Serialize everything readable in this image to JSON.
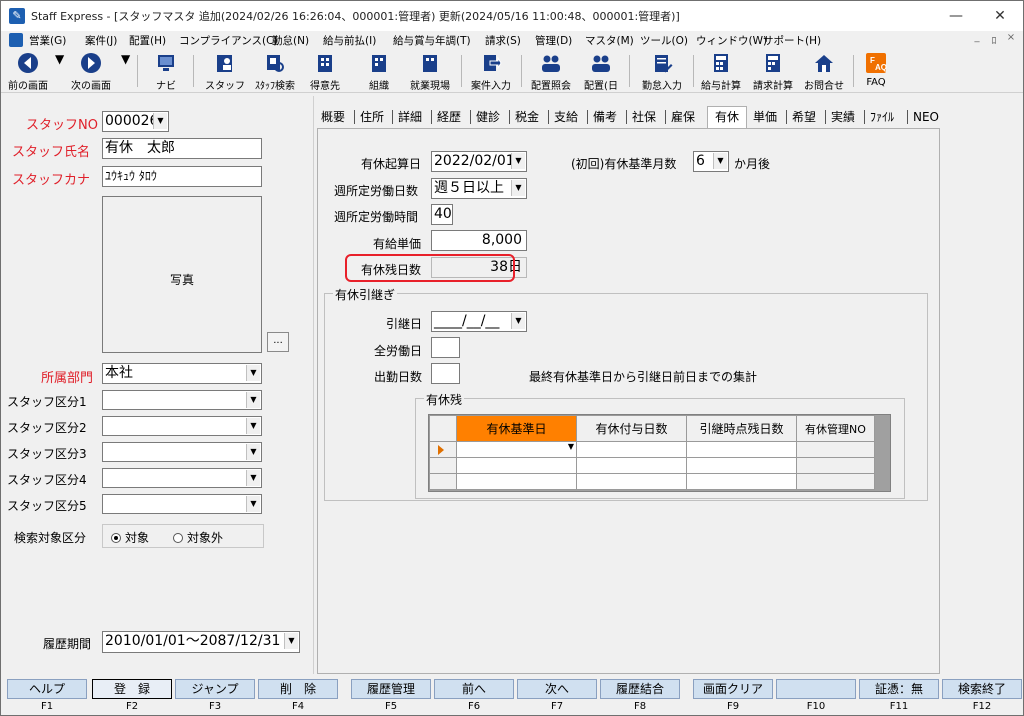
{
  "window": {
    "title": "Staff Express - [スタッフマスタ 追加(2024/02/26 16:26:04、000001:管理者) 更新(2024/05/16 11:00:48、000001:管理者)]",
    "minimize": "—",
    "maximize": "☐",
    "close": "✕"
  },
  "menu": {
    "items": [
      "営業(G)",
      "案件(J)",
      "配置(H)",
      "コンプライアンス(C)",
      "勤怠(N)",
      "給与前払(I)",
      "給与賞与年調(T)",
      "請求(S)",
      "管理(D)",
      "マスタ(M)",
      "ツール(O)",
      "ウィンドウ(W)",
      "サポート(H)"
    ],
    "mdi_min": "_",
    "mdi_restore": "ﾛ",
    "mdi_close": "×"
  },
  "toolbar": {
    "prev": "前の画面",
    "next": "次の画面",
    "navi": "ナビ",
    "staff": "スタッフ",
    "staff_search": "ｽﾀｯﾌ検索",
    "customer": "得意先",
    "org": "組織",
    "site": "就業現場",
    "job_input": "案件入力",
    "assign_ref": "配置照会",
    "assign_day": "配置(日",
    "attendance_input": "勤怠入力",
    "payroll": "給与計算",
    "billing": "請求計算",
    "inquiry": "お問合せ",
    "faq": "FAQ"
  },
  "left": {
    "staff_no_label": "スタッフNO",
    "staff_no": "000026",
    "staff_name_label": "スタッフ氏名",
    "staff_name": "有休　太郎",
    "staff_kana_label": "スタッフカナ",
    "staff_kana": "ﾕｳｷｭｳ ﾀﾛｳ",
    "photo_label": "写真",
    "photo_button": "...",
    "dept_label": "所属部門",
    "dept": "本社",
    "category1_label": "スタッフ区分1",
    "category2_label": "スタッフ区分2",
    "category3_label": "スタッフ区分3",
    "category4_label": "スタッフ区分4",
    "category5_label": "スタッフ区分5",
    "search_target_label": "検索対象区分",
    "search_on": "対象",
    "search_off": "対象外",
    "history_label": "履歴期間",
    "history_period": "2010/01/01～2087/12/31"
  },
  "tabs": [
    "概要",
    "住所",
    "詳細",
    "経歴",
    "健診",
    "税金",
    "支給",
    "備考",
    "社保",
    "雇保",
    "有休",
    "単価",
    "希望",
    "実績",
    "ﾌｧｲﾙ",
    "NEO"
  ],
  "active_tab": "有休",
  "leave": {
    "start_date_label": "有休起算日",
    "start_date": "2022/02/01",
    "base_month_label": "(初回)有休基準月数",
    "base_month": "6",
    "base_month_suffix": "か月後",
    "weekly_days_label": "週所定労働日数",
    "weekly_days": "週５日以上",
    "weekly_hours_label": "週所定労働時間",
    "weekly_hours": "40",
    "unit_price_label": "有給単価",
    "unit_price": "8,000",
    "remaining_label": "有休残日数",
    "remaining": "38日"
  },
  "carryover": {
    "group_title": "有休引継ぎ",
    "date_label": "引継日",
    "date": "____/__/__",
    "full_days_label": "全労働日",
    "attend_days_label": "出勤日数",
    "note": "最終有休基準日から引継日前日までの集計",
    "remain_group_title": "有休残",
    "columns": [
      "有休基準日",
      "有休付与日数",
      "引継時点残日数",
      "有休管理NO"
    ]
  },
  "fkeys": [
    {
      "label": "ヘルプ",
      "key": "F1"
    },
    {
      "label": "登　録",
      "key": "F2"
    },
    {
      "label": "ジャンプ",
      "key": "F3"
    },
    {
      "label": "削　除",
      "key": "F4"
    },
    {
      "label": "履歴管理",
      "key": "F5"
    },
    {
      "label": "前へ",
      "key": "F6"
    },
    {
      "label": "次へ",
      "key": "F7"
    },
    {
      "label": "履歴結合",
      "key": "F8"
    },
    {
      "label": "画面クリア",
      "key": "F9"
    },
    {
      "label": "",
      "key": "F10"
    },
    {
      "label": "証憑：無",
      "key": "F11"
    },
    {
      "label": "検索終了",
      "key": "F12"
    }
  ]
}
